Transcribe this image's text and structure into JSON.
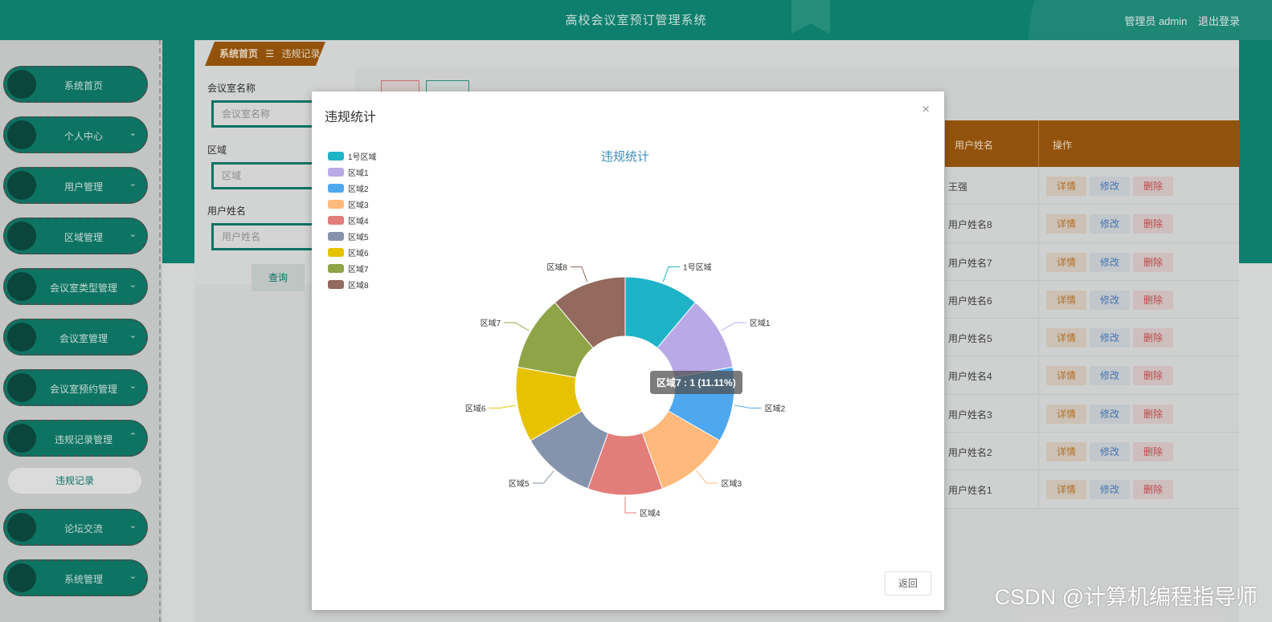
{
  "header": {
    "title": "高校会议室预订管理系统",
    "role": "管理员 admin",
    "logout": "退出登录"
  },
  "sidebar": {
    "items": [
      {
        "label": "系统首页",
        "chevron": ""
      },
      {
        "label": "个人中心",
        "chevron": "⌄"
      },
      {
        "label": "用户管理",
        "chevron": "⌄"
      },
      {
        "label": "区域管理",
        "chevron": "⌄"
      },
      {
        "label": "会议室类型管理",
        "chevron": "⌄"
      },
      {
        "label": "会议室管理",
        "chevron": "⌄"
      },
      {
        "label": "会议室预约管理",
        "chevron": "⌄"
      },
      {
        "label": "违规记录管理",
        "chevron": "⌃"
      },
      {
        "label": "论坛交流",
        "chevron": "⌄"
      },
      {
        "label": "系统管理",
        "chevron": "⌄"
      }
    ],
    "sub_item": "违规记录"
  },
  "breadcrumb": {
    "home": "系统首页",
    "sep": "☰",
    "current": "违规记录"
  },
  "search": {
    "room_label": "会议室名称",
    "room_placeholder": "会议室名称",
    "area_label": "区域",
    "area_placeholder": "区域",
    "user_label": "用户姓名",
    "user_placeholder": "用户姓名",
    "query": "查询"
  },
  "table": {
    "col_user": "用户姓名",
    "col_ops": "操作",
    "detail": "详情",
    "edit": "修改",
    "delete": "删除",
    "rows": [
      "王强",
      "用户姓名8",
      "用户姓名7",
      "用户姓名6",
      "用户姓名5",
      "用户姓名4",
      "用户姓名3",
      "用户姓名2",
      "用户姓名1"
    ]
  },
  "modal": {
    "title": "违规统计",
    "close": "×",
    "back": "返回"
  },
  "tooltip": "区域7 : 1 (11.11%)",
  "watermark": "CSDN @计算机编程指导师",
  "chart_data": {
    "type": "pie",
    "title": "违规统计",
    "legend_position": "top-left",
    "categories": [
      "1号区域",
      "区域1",
      "区域2",
      "区域3",
      "区域4",
      "区域5",
      "区域6",
      "区域7",
      "区域8"
    ],
    "values": [
      1,
      1,
      1,
      1,
      1,
      1,
      1,
      1,
      1
    ],
    "colors": [
      "#1fb3c7",
      "#b9a9e6",
      "#4ea8ef",
      "#ffb97a",
      "#e37d7a",
      "#8693ad",
      "#e6c200",
      "#8fa446",
      "#946a5e"
    ]
  }
}
